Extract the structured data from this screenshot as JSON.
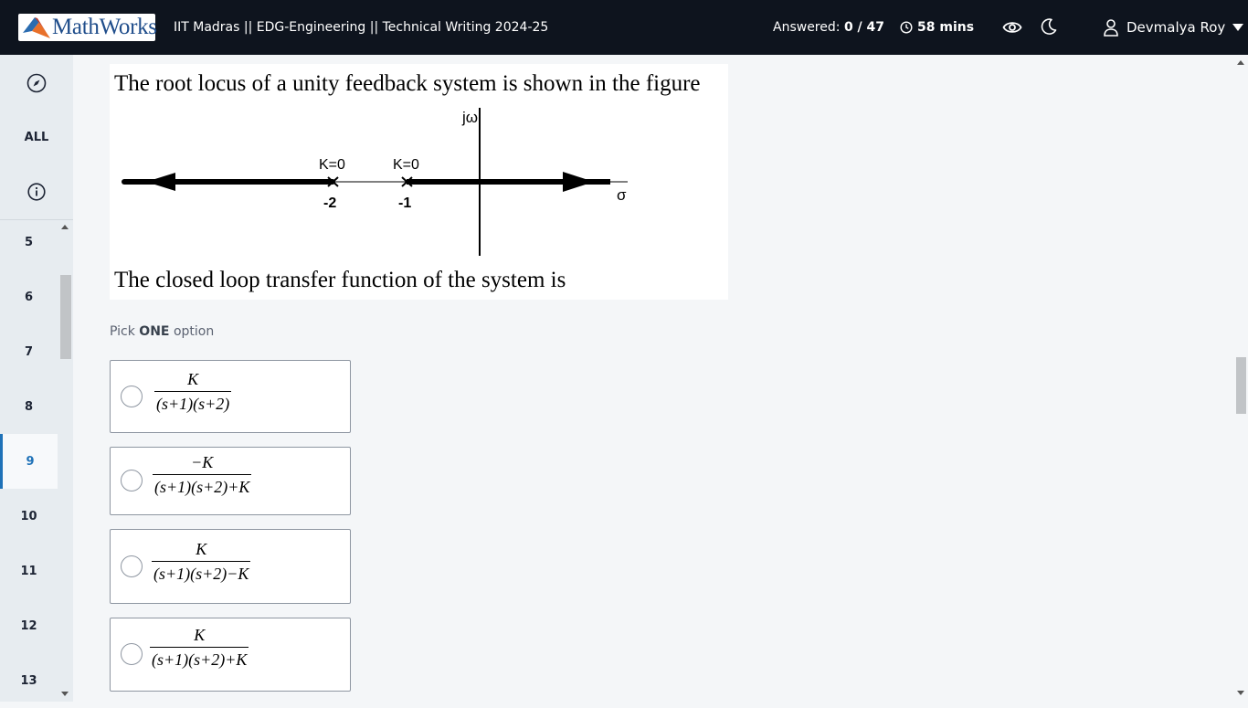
{
  "header": {
    "logo_text": "MathWorks",
    "course": "IIT Madras || EDG-Engineering || Technical Writing 2024-25",
    "answered_label": "Answered:",
    "answered_value": "0 / 47",
    "timer": "58 mins",
    "user_name": "Devmalya Roy",
    "colors": {
      "bar": "#0e141e",
      "text": "#ffffff"
    }
  },
  "sidebar": {
    "all_label": "ALL",
    "question_numbers": [
      "5",
      "6",
      "7",
      "8",
      "9",
      "10",
      "11",
      "12",
      "13"
    ],
    "active_question": "9",
    "colors": {
      "active": "#1f72b8",
      "background": "#e7ecf0"
    }
  },
  "question": {
    "text_top": "The root locus of a unity feedback system is shown in the figure",
    "text_bottom": "The closed loop transfer function of the system is",
    "figure": {
      "axis_jw": "jω",
      "axis_sigma": "σ",
      "pole1_gain": "K=0",
      "pole1_value": "-2",
      "pole2_gain": "K=0",
      "pole2_value": "-1"
    }
  },
  "pick": {
    "prefix": "Pick",
    "bold": "ONE",
    "suffix": "option"
  },
  "options": [
    {
      "num": "K",
      "den_a": "(s+1)(s+2)",
      "den_b": ""
    },
    {
      "num": "−K",
      "den_a": "(s+1)(s+2)",
      "den_b": "+K"
    },
    {
      "num": "K",
      "den_a": "(s+1)(s+2)",
      "den_b": "−K"
    },
    {
      "num": "K",
      "den_a": "(s+1)(s+2)",
      "den_b": "+K"
    }
  ]
}
